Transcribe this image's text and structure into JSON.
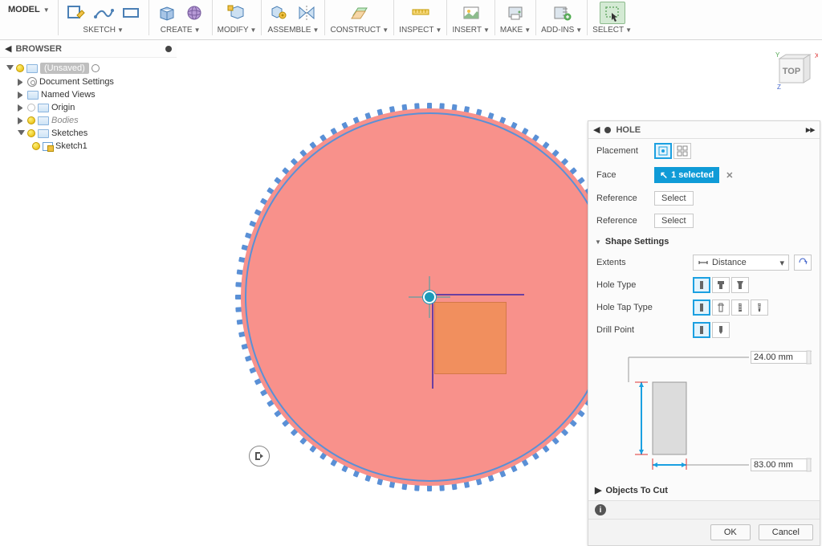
{
  "toolbar": {
    "model": "MODEL",
    "groups": {
      "sketch": "SKETCH",
      "create": "CREATE",
      "modify": "MODIFY",
      "assemble": "ASSEMBLE",
      "construct": "CONSTRUCT",
      "inspect": "INSPECT",
      "insert": "INSERT",
      "make": "MAKE",
      "addins": "ADD-INS",
      "select": "SELECT"
    }
  },
  "viewcube": {
    "face": "TOP",
    "axes": [
      "X",
      "Y",
      "Z"
    ]
  },
  "browser": {
    "title": "BROWSER",
    "root": "(Unsaved)",
    "nodes": {
      "doc_settings": "Document Settings",
      "named_views": "Named Views",
      "origin": "Origin",
      "bodies": "Bodies",
      "sketches": "Sketches",
      "sketch1": "Sketch1"
    }
  },
  "panel": {
    "title": "HOLE",
    "placement_label": "Placement",
    "face_label": "Face",
    "face_value": "1 selected",
    "reference_label": "Reference",
    "reference_value": "Select",
    "shape_settings": "Shape Settings",
    "extents_label": "Extents",
    "extents_value": "Distance",
    "hole_type": "Hole Type",
    "hole_tap": "Hole Tap Type",
    "drill_point": "Drill Point",
    "dim1": "24.00 mm",
    "dim2": "83.00 mm",
    "objects_to_cut": "Objects To Cut",
    "ok": "OK",
    "cancel": "Cancel"
  }
}
